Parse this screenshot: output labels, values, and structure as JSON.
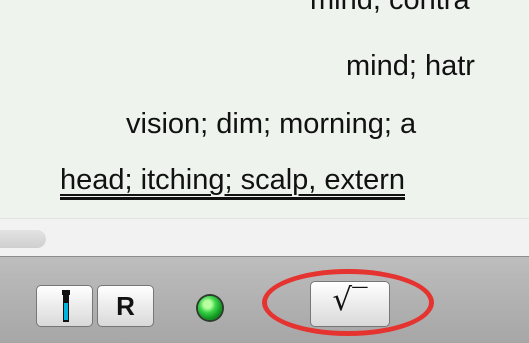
{
  "content": {
    "lines": [
      "mind, contra",
      "mind; hatr",
      "vision; dim; morning; a",
      "head; itching; scalp, extern"
    ]
  },
  "toolbar": {
    "r_label": "R",
    "check_label": "√‾",
    "led_color": "#3bd44a",
    "highlight_color": "#e53430"
  },
  "icons": {
    "remedy": "vial-icon",
    "status": "green-led-icon"
  }
}
